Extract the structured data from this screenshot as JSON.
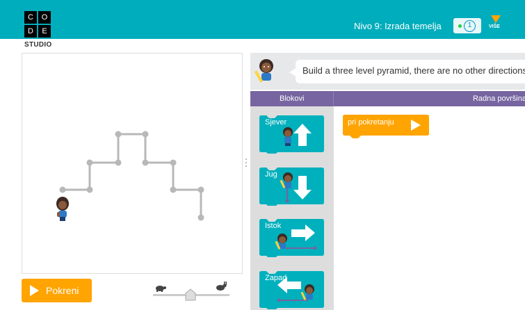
{
  "logo": {
    "letters": [
      "C",
      "O",
      "D",
      "E"
    ],
    "subtitle": "STUDIO"
  },
  "header": {
    "level_title": "Nivo 9: Izrada temelja",
    "progress_number": "1",
    "more_label": "VIŠE",
    "background_color": "#00adbc"
  },
  "instructions": {
    "text": "Build a three level pyramid, there are no other directions."
  },
  "tabs": {
    "blocks": "Blokovi",
    "workspace": "Radna površina"
  },
  "toolbox": {
    "blocks": [
      {
        "label": "Sjever",
        "arrow": "arrow-up-icon"
      },
      {
        "label": "Jug",
        "arrow": "arrow-down-icon"
      },
      {
        "label": "Istok",
        "arrow": "arrow-right-icon"
      },
      {
        "label": "Zapad",
        "arrow": "arrow-left-icon"
      }
    ],
    "block_color": "#00b0bd"
  },
  "workspace": {
    "start_block": "pri pokretanju",
    "start_color": "#ffa400"
  },
  "run_button": {
    "label": "Pokreni",
    "color": "#ffa400"
  },
  "speed": {
    "slow_icon": "turtle-icon",
    "fast_icon": "rabbit-icon",
    "level": 0.5
  }
}
